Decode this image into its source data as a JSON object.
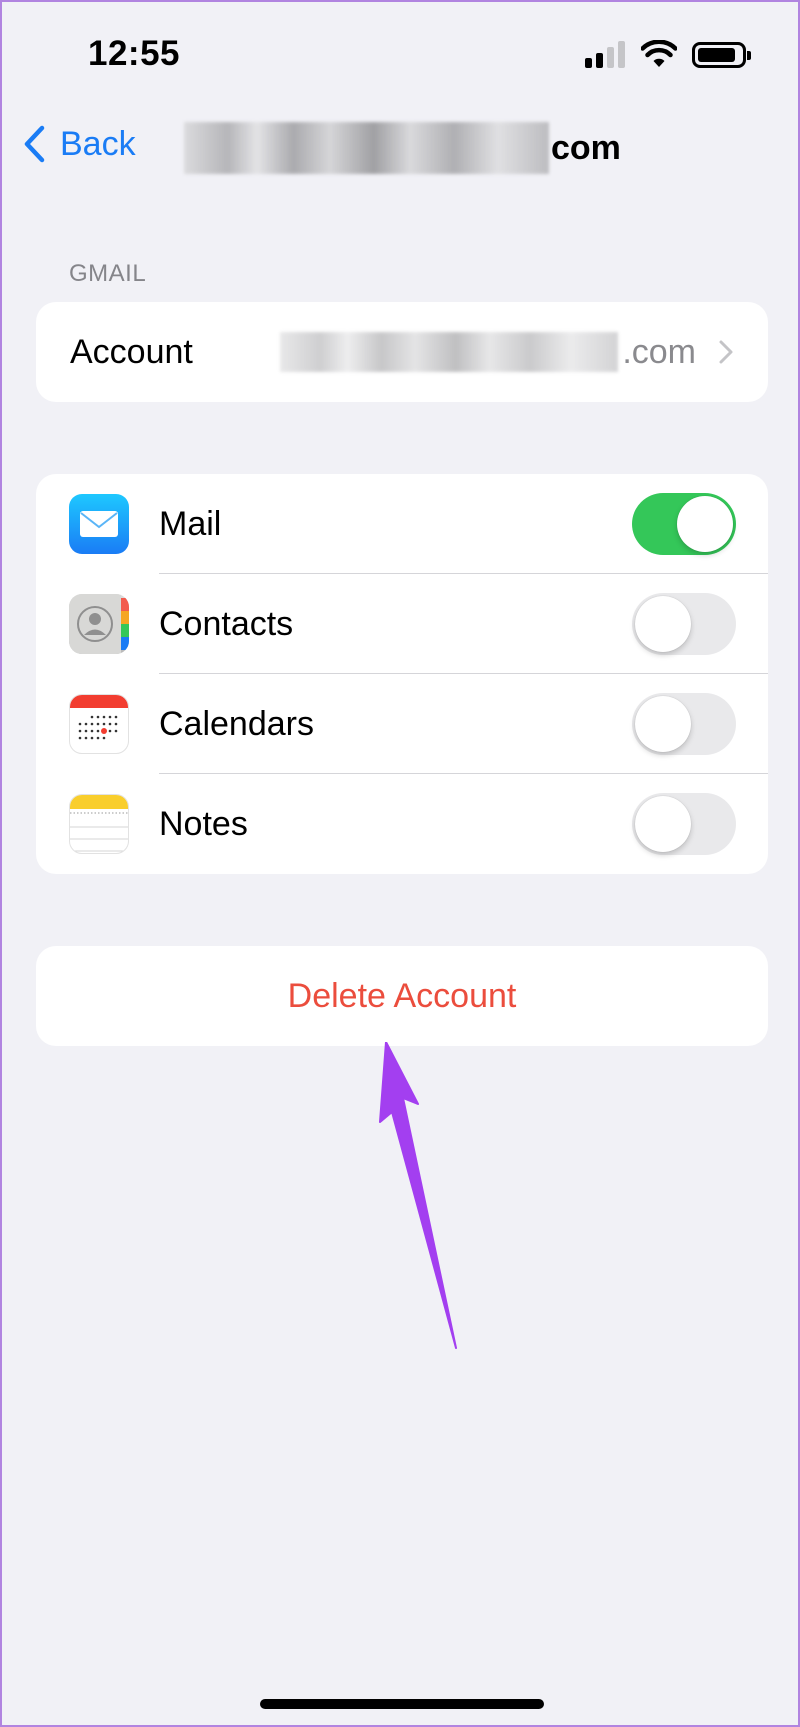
{
  "status_bar": {
    "time": "12:55"
  },
  "nav": {
    "back_label": "Back",
    "title_suffix": "com"
  },
  "section": {
    "header": "GMAIL"
  },
  "account": {
    "label": "Account",
    "value_suffix": ".com"
  },
  "services": [
    {
      "label": "Mail",
      "icon": "mail-icon",
      "enabled": true
    },
    {
      "label": "Contacts",
      "icon": "contacts-icon",
      "enabled": false
    },
    {
      "label": "Calendars",
      "icon": "calendar-icon",
      "enabled": false
    },
    {
      "label": "Notes",
      "icon": "notes-icon",
      "enabled": false
    }
  ],
  "actions": {
    "delete_label": "Delete Account"
  },
  "colors": {
    "accent": "#1a7cf5",
    "destructive": "#eb4d3d",
    "toggle_on": "#34c759",
    "annotation_arrow": "#a33ff0",
    "background": "#f1f1f6"
  }
}
